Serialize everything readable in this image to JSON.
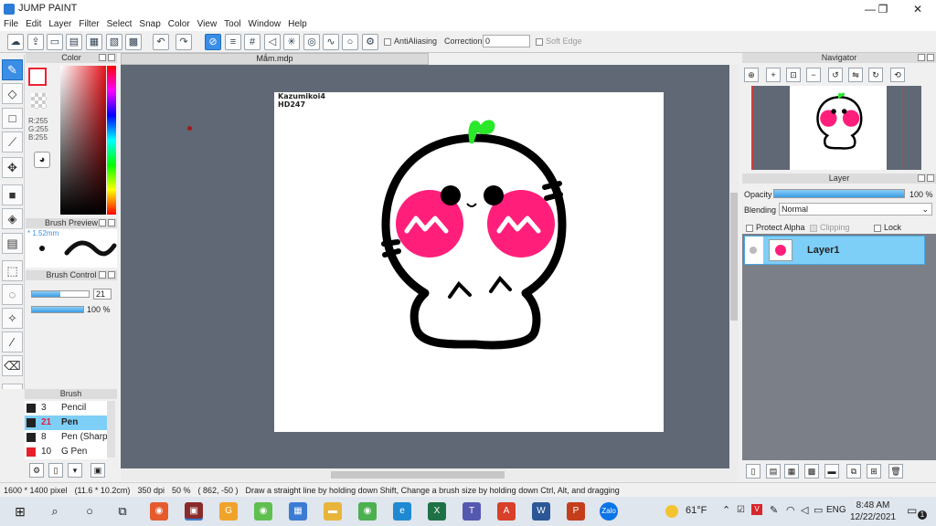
{
  "window": {
    "title": "JUMP PAINT",
    "minimize": "—",
    "maximize": "❐",
    "close": "✕"
  },
  "menu": [
    "File",
    "Edit",
    "Layer",
    "Filter",
    "Select",
    "Snap",
    "Color",
    "View",
    "Tool",
    "Window",
    "Help"
  ],
  "toolbar": {
    "antialiasing_label": "AntiAliasing",
    "correction_label": "Correction",
    "correction_value": "0",
    "soft_edge_label": "Soft Edge"
  },
  "color_panel": {
    "title": "Color",
    "rgb_r": "R:255",
    "rgb_g": "G:255",
    "rgb_b": "B:255"
  },
  "brush_preview": {
    "title": "Brush Preview",
    "size": "* 1.52mm"
  },
  "brush_control": {
    "title": "Brush Control",
    "size_value": "21",
    "opacity_value": "100 %",
    "size_fraction": 0.5,
    "opacity_fraction": 1.0
  },
  "brush_list": {
    "title": "Brush",
    "items": [
      {
        "size": "3",
        "name": "Pencil",
        "color": "#222222",
        "selected": false
      },
      {
        "size": "21",
        "name": "Pen",
        "color": "#222222",
        "selected": true
      },
      {
        "size": "8",
        "name": "Pen (Sharp)",
        "color": "#222222",
        "selected": false
      },
      {
        "size": "10",
        "name": "G Pen",
        "color": "#e8202a",
        "selected": false
      }
    ]
  },
  "document": {
    "tab_title": "Mắm.mdp",
    "signature_line1": "Kazumikoi4",
    "signature_line2": "HD247"
  },
  "navigator": {
    "title": "Navigator"
  },
  "layer_panel": {
    "title": "Layer",
    "opacity_label": "Opacity",
    "opacity_value": "100 %",
    "opacity_fraction": 1.0,
    "blending_label": "Blending",
    "blending_value": "Normal",
    "protect_alpha_label": "Protect Alpha",
    "clipping_label": "Clipping",
    "lock_label": "Lock",
    "layer_name": "Layer1"
  },
  "status": {
    "pixel_size": "1600 * 1400 pixel",
    "cm_size": "(11.6 * 10.2cm)",
    "dpi": "350 dpi",
    "zoom": "50 %",
    "coords": "( 862, -50 )",
    "hint": "Draw a straight line by holding down Shift, Change a brush size by holding down Ctrl, Alt, and dragging"
  },
  "taskbar": {
    "weather": "61°F",
    "language": "ENG",
    "time": "8:48 AM",
    "date": "12/22/2021",
    "notification_count": "1"
  },
  "colors": {
    "accent": "#3a8ee6",
    "layer_selected": "#7ecff7",
    "workspace": "#616875"
  }
}
